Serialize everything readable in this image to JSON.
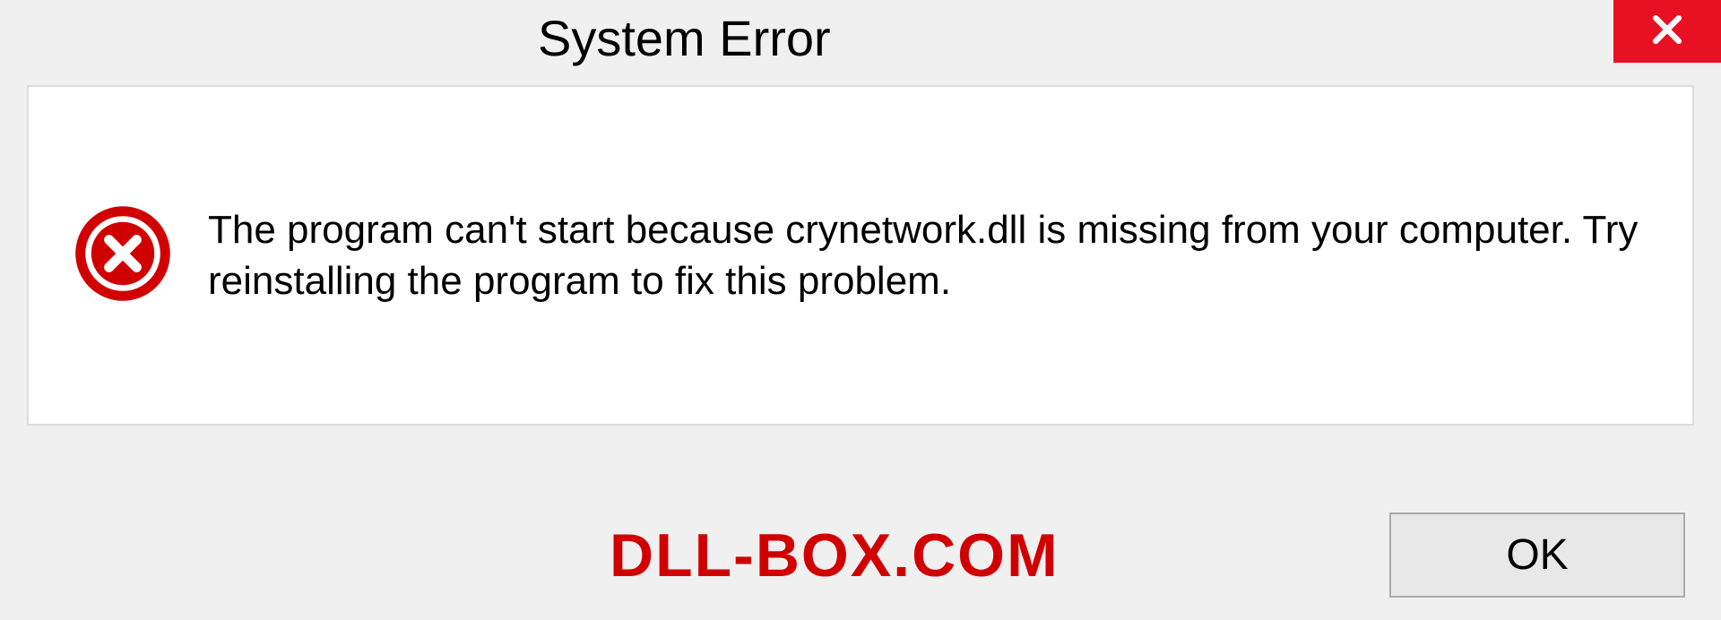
{
  "title": "System Error",
  "message": "The program can't start because crynetwork.dll is missing from your computer. Try reinstalling the program to fix this problem.",
  "watermark": "DLL-BOX.COM",
  "buttons": {
    "ok_label": "OK"
  }
}
